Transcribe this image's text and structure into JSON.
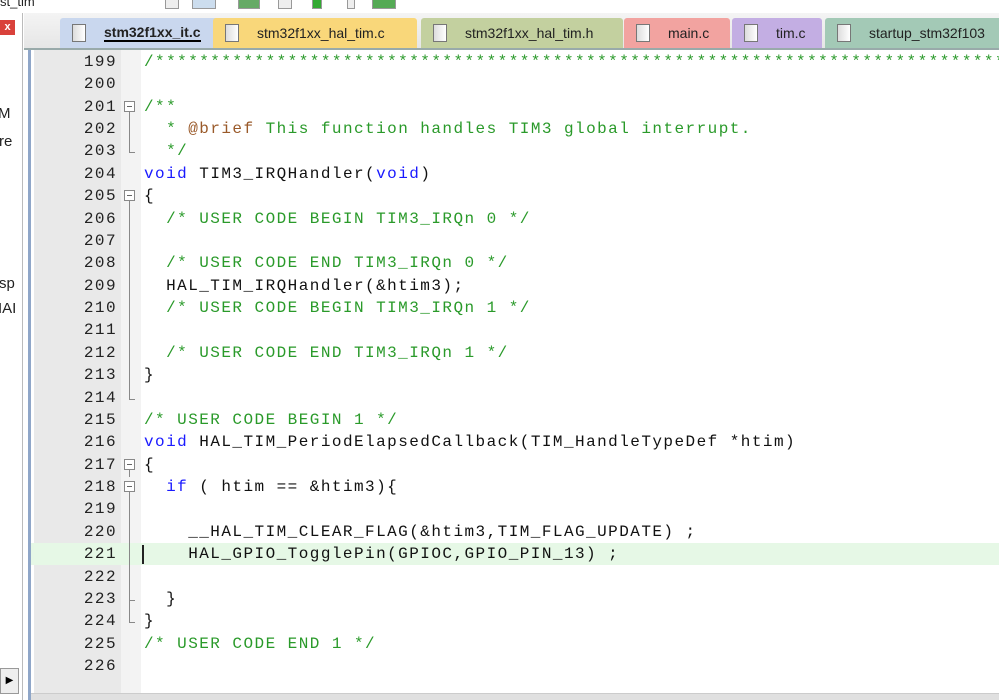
{
  "window": {
    "title_fragment": "st_tim"
  },
  "left_panel": {
    "close_label": "x",
    "fragments": [
      "M",
      "re",
      "sp",
      "IAI"
    ],
    "scroll_arrow": "▶"
  },
  "tabs": [
    {
      "label": "stm32f1xx_it.c",
      "color": "#c9d7ee",
      "active": true
    },
    {
      "label": "stm32f1xx_hal_tim.c",
      "color": "#f9d77a",
      "active": false
    },
    {
      "label": "stm32f1xx_hal_tim.h",
      "color": "#c3d09f",
      "active": false
    },
    {
      "label": "main.c",
      "color": "#f2a3a0",
      "active": false
    },
    {
      "label": "tim.c",
      "color": "#c3aee3",
      "active": false
    },
    {
      "label": "startup_stm32f103",
      "color": "#a3c9b6",
      "active": false
    }
  ],
  "editor": {
    "current_line": 221,
    "lines": [
      {
        "n": "199",
        "segs": [
          [
            "cm",
            "/******************************************************************************"
          ]
        ]
      },
      {
        "n": "200",
        "segs": []
      },
      {
        "n": "201",
        "fold": "open",
        "segs": [
          [
            "cm",
            "/**"
          ]
        ]
      },
      {
        "n": "202",
        "fold": "mid",
        "segs": [
          [
            "cm",
            "  * "
          ],
          [
            "dc",
            "@brief"
          ],
          [
            "cm",
            " This function handles TIM3 global interrupt."
          ]
        ]
      },
      {
        "n": "203",
        "fold": "end",
        "segs": [
          [
            "cm",
            "  */"
          ]
        ]
      },
      {
        "n": "204",
        "segs": [
          [
            "kw",
            "void"
          ],
          [
            "tx",
            " TIM3_IRQHandler("
          ],
          [
            "kw",
            "void"
          ],
          [
            "tx",
            ")"
          ]
        ]
      },
      {
        "n": "205",
        "fold": "open",
        "segs": [
          [
            "tx",
            "{"
          ]
        ]
      },
      {
        "n": "206",
        "fold": "mid",
        "segs": [
          [
            "cm",
            "  /* USER CODE BEGIN TIM3_IRQn 0 */"
          ]
        ]
      },
      {
        "n": "207",
        "fold": "mid",
        "segs": []
      },
      {
        "n": "208",
        "fold": "mid",
        "segs": [
          [
            "cm",
            "  /* USER CODE END TIM3_IRQn 0 */"
          ]
        ]
      },
      {
        "n": "209",
        "fold": "mid",
        "segs": [
          [
            "tx",
            "  HAL_TIM_IRQHandler(&htim3);"
          ]
        ]
      },
      {
        "n": "210",
        "fold": "mid",
        "segs": [
          [
            "cm",
            "  /* USER CODE BEGIN TIM3_IRQn 1 */"
          ]
        ]
      },
      {
        "n": "211",
        "fold": "mid",
        "segs": []
      },
      {
        "n": "212",
        "fold": "mid",
        "segs": [
          [
            "cm",
            "  /* USER CODE END TIM3_IRQn 1 */"
          ]
        ]
      },
      {
        "n": "213",
        "fold": "mid",
        "segs": [
          [
            "tx",
            "}"
          ]
        ]
      },
      {
        "n": "214",
        "fold": "end",
        "segs": []
      },
      {
        "n": "215",
        "segs": [
          [
            "cm",
            "/* USER CODE BEGIN 1 */"
          ]
        ]
      },
      {
        "n": "216",
        "segs": [
          [
            "kw",
            "void"
          ],
          [
            "tx",
            " HAL_TIM_PeriodElapsedCallback(TIM_HandleTypeDef *htim)"
          ]
        ]
      },
      {
        "n": "217",
        "fold": "open",
        "segs": [
          [
            "tx",
            "{"
          ]
        ]
      },
      {
        "n": "218",
        "fold": "open",
        "segs": [
          [
            "tx",
            "  "
          ],
          [
            "kw",
            "if"
          ],
          [
            "tx",
            " ( htim == &htim3){"
          ]
        ]
      },
      {
        "n": "219",
        "fold": "mid",
        "segs": []
      },
      {
        "n": "220",
        "fold": "mid",
        "segs": [
          [
            "tx",
            "    __HAL_TIM_CLEAR_FLAG(&htim3,TIM_FLAG_UPDATE) ;"
          ]
        ]
      },
      {
        "n": "221",
        "fold": "mid",
        "segs": [
          [
            "tx",
            "    HAL_GPIO_TogglePin(GPIOC,GPIO_PIN_13) ;"
          ]
        ]
      },
      {
        "n": "222",
        "fold": "mid",
        "segs": []
      },
      {
        "n": "223",
        "fold": "tick",
        "segs": [
          [
            "tx",
            "  }"
          ]
        ]
      },
      {
        "n": "224",
        "fold": "end",
        "segs": [
          [
            "tx",
            "}"
          ]
        ]
      },
      {
        "n": "225",
        "segs": [
          [
            "cm",
            "/* USER CODE END 1 */"
          ]
        ]
      },
      {
        "n": "226",
        "segs": []
      }
    ]
  }
}
